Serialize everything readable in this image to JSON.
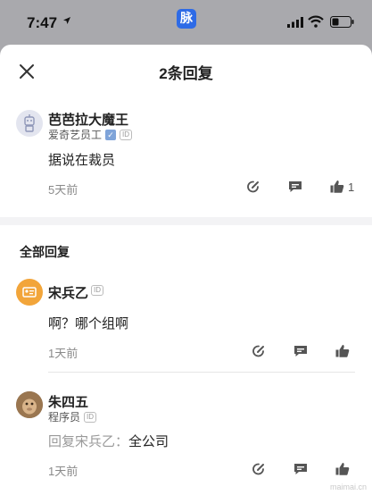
{
  "status_bar": {
    "time": "7:47",
    "app_badge": "脉"
  },
  "sheet": {
    "title": "2条回复"
  },
  "main_comment": {
    "name": "芭芭拉大魔王",
    "company": "爱奇艺员工",
    "verified_mark": "✓",
    "id_tag": "ID",
    "content": "据说在裁员",
    "time": "5天前",
    "like_count": "1"
  },
  "replies_section": {
    "title": "全部回复"
  },
  "replies": [
    {
      "name": "宋兵乙",
      "id_tag": "ID",
      "content": "啊？哪个组啊",
      "time": "1天前"
    },
    {
      "name": "朱四五",
      "title": "程序员",
      "id_tag": "ID",
      "reply_prefix": "回复宋兵乙：",
      "content": "全公司",
      "time": "1天前"
    }
  ],
  "watermark": "maimai.cn",
  "colors": {
    "accent": "#2e6be6",
    "muted": "#8a8a8a",
    "avatar_orange": "#f2a53a"
  }
}
